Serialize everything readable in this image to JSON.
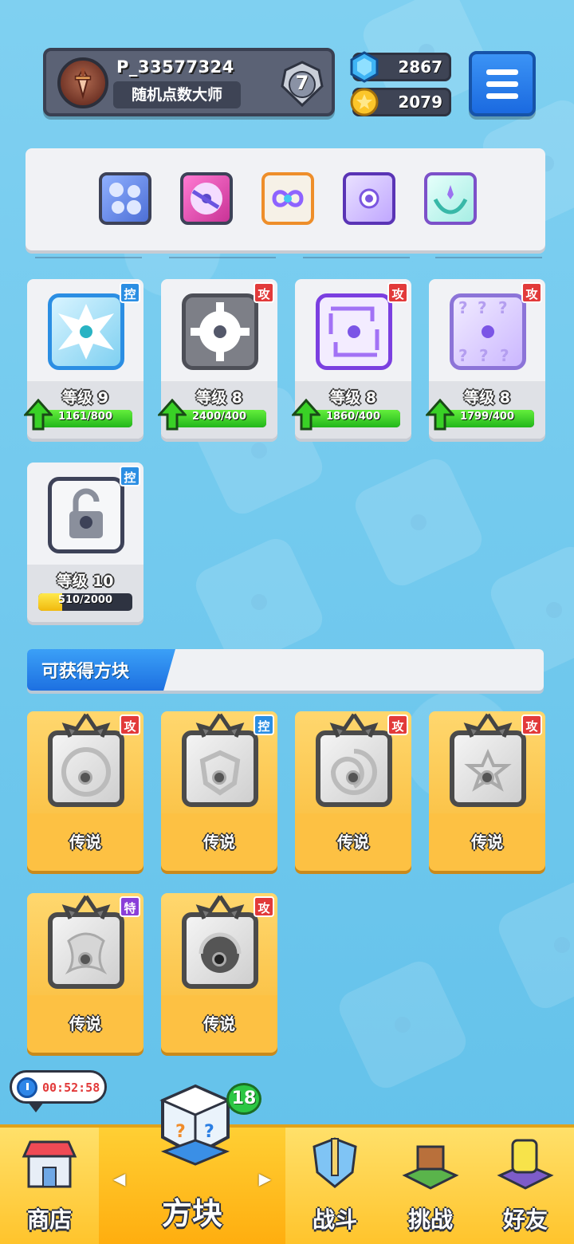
{
  "player": {
    "username": "P_33577324",
    "title": "随机点数大师",
    "rank": "7"
  },
  "currency": {
    "gems": "2867",
    "gold": "2079"
  },
  "deck": [
    {
      "icon": "gear-dice-icon",
      "color": "#6a8ff0"
    },
    {
      "icon": "swap-dice-icon",
      "color": "#e24fb2"
    },
    {
      "icon": "infinity-dice-icon",
      "color": "#f0a23a"
    },
    {
      "icon": "crystal-dice-icon",
      "color": "#8c5be6"
    },
    {
      "icon": "hands-dice-icon",
      "color": "#36c3b6"
    }
  ],
  "owned": [
    {
      "level": "等级 9",
      "progress": "1161/800",
      "tag": "控",
      "tag_type": "ctl",
      "ratio": 1.0
    },
    {
      "level": "等级 8",
      "progress": "2400/400",
      "tag": "攻",
      "tag_type": "atk",
      "ratio": 1.0
    },
    {
      "level": "等级 8",
      "progress": "1860/400",
      "tag": "攻",
      "tag_type": "atk",
      "ratio": 1.0
    },
    {
      "level": "等级 8",
      "progress": "1799/400",
      "tag": "攻",
      "tag_type": "atk",
      "ratio": 1.0
    },
    {
      "level": "等级 10",
      "progress": "510/2000",
      "tag": "控",
      "tag_type": "ctl",
      "ratio": 0.255
    }
  ],
  "available": {
    "title": "可获得方块",
    "items": [
      {
        "rarity": "传说",
        "tag": "攻",
        "tag_type": "atk"
      },
      {
        "rarity": "传说",
        "tag": "控",
        "tag_type": "ctl"
      },
      {
        "rarity": "传说",
        "tag": "攻",
        "tag_type": "atk"
      },
      {
        "rarity": "传说",
        "tag": "攻",
        "tag_type": "atk"
      },
      {
        "rarity": "传说",
        "tag": "特",
        "tag_type": "spc"
      },
      {
        "rarity": "传说",
        "tag": "攻",
        "tag_type": "atk"
      }
    ]
  },
  "timer": "00:52:58",
  "nav": {
    "badge": "18",
    "shop": "商店",
    "dice": "方块",
    "battle": "战斗",
    "challenge": "挑战",
    "friends": "好友"
  }
}
